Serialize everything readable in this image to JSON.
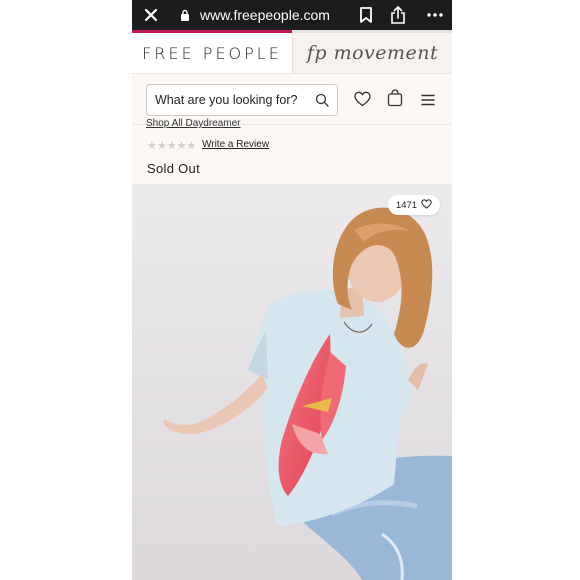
{
  "browser": {
    "url": "www.freepeople.com",
    "close_icon": "close-icon",
    "lock_icon": "lock-icon",
    "bookmark_icon": "bookmark-icon",
    "share_icon": "share-icon",
    "more_icon": "more-icon"
  },
  "brand": {
    "primary": "FREE PEOPLE",
    "secondary": "fp movement",
    "accent": "#c2185b"
  },
  "search": {
    "placeholder": "What are you looking for?",
    "value": ""
  },
  "header_icons": [
    "heart-icon",
    "bag-icon",
    "menu-icon"
  ],
  "product": {
    "breadcrumb": "Shop All Daydreamer",
    "stars": "★★★★★",
    "review_link": "Write a Review",
    "status": "Sold Out",
    "likes": "1471"
  }
}
